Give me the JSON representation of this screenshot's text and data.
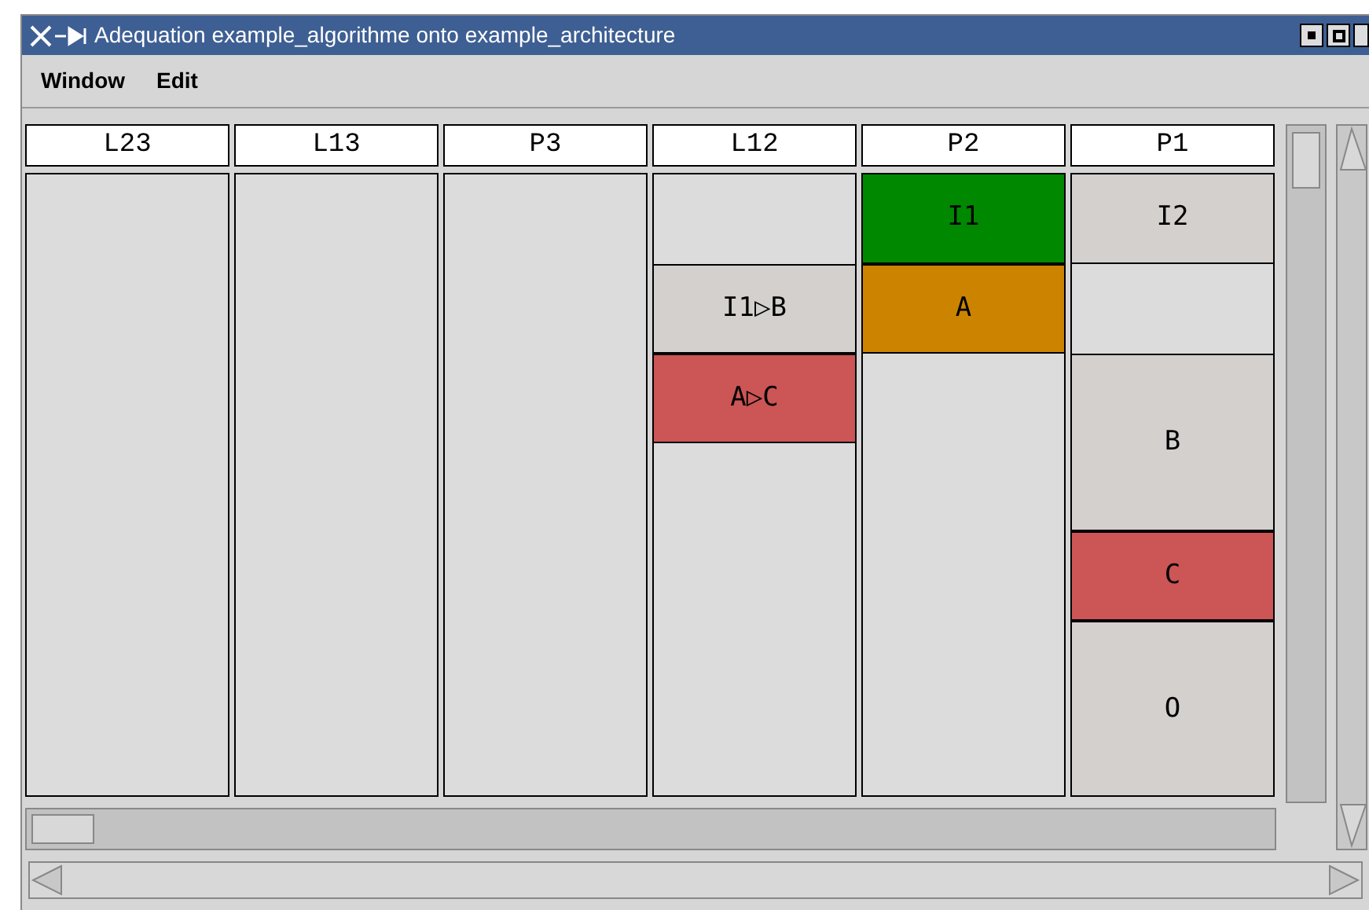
{
  "window": {
    "title": "Adequation example_algorithme onto example_architecture"
  },
  "menu": [
    "Window",
    "Edit"
  ],
  "columns": [
    {
      "header": "L23",
      "blocks": [
        {
          "kind": "rest"
        }
      ]
    },
    {
      "header": "L13",
      "blocks": [
        {
          "kind": "rest"
        }
      ]
    },
    {
      "header": "P3",
      "blocks": [
        {
          "kind": "rest"
        }
      ]
    },
    {
      "header": "L12",
      "blocks": [
        {
          "kind": "gap"
        },
        {
          "kind": "short",
          "label": "I1▷B",
          "color": "#d3d0ce"
        },
        {
          "kind": "short",
          "label": "A▷C",
          "color": "#cc5555"
        },
        {
          "kind": "rest"
        }
      ]
    },
    {
      "header": "P2",
      "blocks": [
        {
          "kind": "short",
          "label": "I1",
          "color": "#008800"
        },
        {
          "kind": "short",
          "label": "A",
          "color": "#cc8400"
        },
        {
          "kind": "rest"
        }
      ]
    },
    {
      "header": "P1",
      "blocks": [
        {
          "kind": "short",
          "label": "I2",
          "color": "#d3d0ce"
        },
        {
          "kind": "gap"
        },
        {
          "kind": "long",
          "label": "B",
          "color": "#d3d0ce"
        },
        {
          "kind": "short",
          "label": "C",
          "color": "#cc5555"
        },
        {
          "kind": "long",
          "label": "O",
          "color": "#d3d0ce"
        }
      ]
    }
  ]
}
